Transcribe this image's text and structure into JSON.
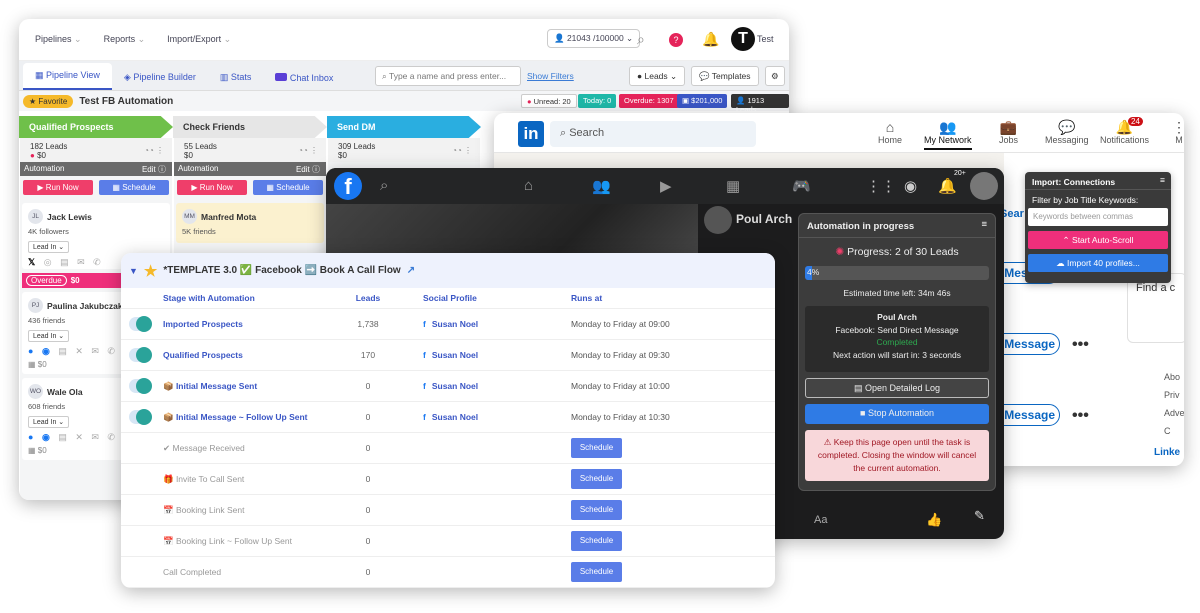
{
  "crm": {
    "menu": [
      "Pipelines",
      "Reports",
      "Import/Export"
    ],
    "credits": "21043 /100000",
    "notif_badge": "?",
    "avatar_letter": "T",
    "user": "Test",
    "tabs": [
      "Pipeline View",
      "Pipeline Builder",
      "Stats",
      "Chat Inbox"
    ],
    "search_placeholder": "Type a name and press enter...",
    "show_filters": "Show Filters",
    "leads_btn": "Leads",
    "templates_btn": "Templates",
    "favorite": "Favorite",
    "pipeline_title": "Test FB Automation",
    "badges": {
      "unread": "Unread: 20",
      "today": "Today: 0",
      "overdue": "Overdue: 1307",
      "money": "$201,000",
      "total": "1913 Leads"
    },
    "stages": [
      {
        "name": "Qualified Prospects",
        "leads": "182 Leads",
        "amount": "$0",
        "color": "#6fc04a"
      },
      {
        "name": "Check Friends",
        "leads": "55 Leads",
        "amount": "$0",
        "color": "#e6e6e6"
      },
      {
        "name": "Send DM",
        "leads": "309 Leads",
        "amount": "$0",
        "color": "#2aaee0"
      }
    ],
    "automation_label": "Automation",
    "edit_label": "Edit",
    "run_now": "Run Now",
    "schedule": "Schedule",
    "col1_leads": [
      {
        "ini": "JL",
        "name": "Jack Lewis",
        "followers": "4K followers",
        "status": "Lead In"
      },
      {
        "ini": "PJ",
        "name": "Paulina Jakubczak",
        "followers": "436 friends",
        "status": "Lead In",
        "amount": "$0"
      },
      {
        "ini": "WO",
        "name": "Wale Ola",
        "followers": "608 friends",
        "status": "Lead In",
        "amount": "$0"
      }
    ],
    "col2_leads": [
      {
        "ini": "MM",
        "name": "Manfred Mota",
        "followers": "5K friends"
      }
    ],
    "overdue_label": "Overdue",
    "overdue_amount": "$0"
  },
  "linkedin": {
    "logo": "in",
    "search": "Search",
    "nav": [
      {
        "label": "Home",
        "icon": "home-icon"
      },
      {
        "label": "My Network",
        "icon": "network-icon"
      },
      {
        "label": "Jobs",
        "icon": "jobs-icon"
      },
      {
        "label": "Messaging",
        "icon": "messaging-icon"
      },
      {
        "label": "Notifications",
        "icon": "bell-icon",
        "badge": "24"
      },
      {
        "label": "M",
        "icon": "me-icon"
      }
    ],
    "message_btn": "Message",
    "search_partial": "Sear",
    "find_partial": "Find a c",
    "side_links": [
      "Abo",
      "Priv",
      "Adve",
      "C"
    ],
    "footer_partial": "Linke"
  },
  "facebook": {
    "logo": "f",
    "profile_name": "Poul Arch",
    "comment_icon": "Aa",
    "notif_count": "20+"
  },
  "automation": {
    "title": "Automation in progress",
    "progress": "Progress: 2 of 30 Leads",
    "percent": "4%",
    "percent_value": 4,
    "eta": "Estimated time left: 34m 46s",
    "lead_name": "Poul Arch",
    "action": "Facebook: Send Direct Message",
    "status": "Completed",
    "next": "Next action will start in: 3 seconds",
    "open_log": "Open Detailed Log",
    "stop": "Stop Automation",
    "warning": "Keep this page open until the task is completed. Closing the window will cancel the current automation."
  },
  "import": {
    "title": "Import: Connections",
    "filter_label": "Filter by Job Title Keywords:",
    "placeholder": "Keywords between commas",
    "start": "Start Auto-Scroll",
    "import_btn": "Import 40 profiles..."
  },
  "template": {
    "title": "*TEMPLATE 3.0 ✅ Facebook ➡️ Book A Call Flow",
    "headers": [
      "Stage with Automation",
      "Leads",
      "Social Profile",
      "Runs at"
    ],
    "rows": [
      {
        "stage": "Imported Prospects",
        "leads": "1,738",
        "profile": "Susan Noel",
        "runs": "Monday to Friday at 09:00",
        "active": true
      },
      {
        "stage": "Qualified Prospects",
        "leads": "170",
        "profile": "Susan Noel",
        "runs": "Monday to Friday at 09:30",
        "active": true
      },
      {
        "stage": "📦 Initial Message Sent",
        "leads": "0",
        "profile": "Susan Noel",
        "runs": "Monday to Friday at 10:00",
        "active": true
      },
      {
        "stage": "📦 Initial Message ~ Follow Up Sent",
        "leads": "0",
        "profile": "Susan Noel",
        "runs": "Monday to Friday at 10:30",
        "active": true
      },
      {
        "stage": "✔ Message Received",
        "leads": "0",
        "action": "Schedule",
        "active": false
      },
      {
        "stage": "🎁 Invite To Call Sent",
        "leads": "0",
        "action": "Schedule",
        "active": false
      },
      {
        "stage": "📅 Booking Link Sent",
        "leads": "0",
        "action": "Schedule",
        "active": false
      },
      {
        "stage": "📅 Booking Link ~ Follow Up Sent",
        "leads": "0",
        "action": "Schedule",
        "active": false
      },
      {
        "stage": "Call Completed",
        "leads": "0",
        "action": "Schedule",
        "active": false
      }
    ]
  }
}
